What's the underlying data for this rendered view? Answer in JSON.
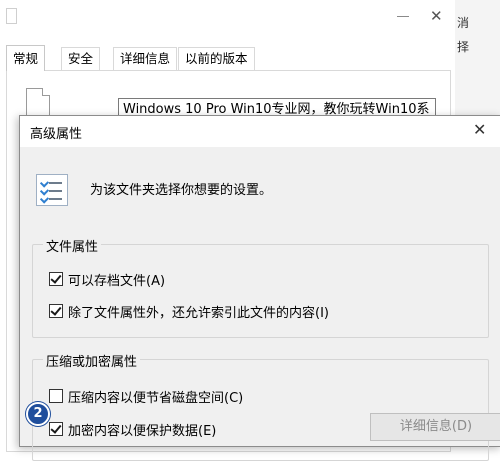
{
  "bg_window": {
    "tabs": [
      "常规",
      "安全",
      "详细信息",
      "以前的版本"
    ],
    "name_value": "Windows 10 Pro  Win10专业网，教你玩转Win10系"
  },
  "edge_window": {
    "chars": [
      "消",
      "择"
    ]
  },
  "dialog": {
    "title": "高级属性",
    "intro": "为该文件夹选择你想要的设置。",
    "file_attrs": {
      "label": "文件属性",
      "options": [
        {
          "label": "可以存档文件(A)",
          "checked": true
        },
        {
          "label": "除了文件属性外，还允许索引此文件的内容(I)",
          "checked": true
        }
      ]
    },
    "compress_attrs": {
      "label": "压缩或加密属性",
      "options": [
        {
          "label": "压缩内容以便节省磁盘空间(C)",
          "checked": false
        },
        {
          "label": "加密内容以便保护数据(E)",
          "checked": true
        }
      ],
      "details_button": "详细信息(D)"
    }
  },
  "badge": "2",
  "colors": {
    "badge": "#1f4e9c",
    "dialog_bg": "#f0f0f0"
  }
}
